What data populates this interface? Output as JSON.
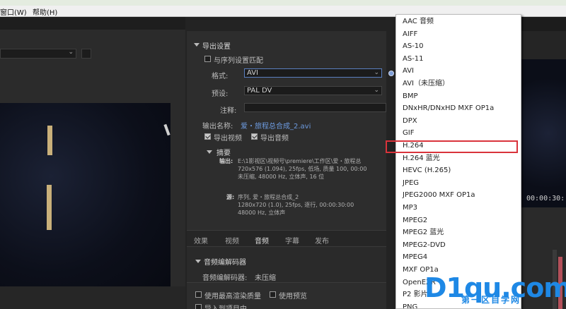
{
  "menu": {
    "items": [
      "窗口(W)",
      "帮助(H)"
    ]
  },
  "export_settings": {
    "section_title": "导出设置",
    "match_sequence_label": "与序列设置匹配",
    "format_label": "格式:",
    "format_value": "AVI",
    "preset_label": "预设:",
    "preset_value": "PAL DV",
    "comments_label": "注释:",
    "comments_value": "",
    "output_name_label": "输出名称:",
    "output_name_value": "爱・旅程总合成_2.avi",
    "export_video_label": "导出视频",
    "export_audio_label": "导出音频",
    "export_video_checked": true,
    "export_audio_checked": true
  },
  "summary": {
    "title": "摘要",
    "output_label": "输出:",
    "output_lines": [
      "E:\\1影视区\\视频号\\premiere\\工作区\\爱・旅程总",
      "720x576 (1.094), 25fps, 低场, 质量 100, 00:00",
      "未压缩, 48000 Hz, 立体声, 16 位"
    ],
    "source_label": "源:",
    "source_lines": [
      "序列, 爱・旅程总合成_2",
      "1280x720 (1.0), 25fps, 逐行, 00:00:30:00",
      "48000 Hz, 立体声"
    ]
  },
  "tabs": [
    "效果",
    "视频",
    "音频",
    "字幕",
    "发布"
  ],
  "active_tab": "音频",
  "audio_codec": {
    "section_title": "音频编解码器",
    "codec_label": "音频编解码器:",
    "codec_value": "未压缩"
  },
  "bottom_options": {
    "max_render_quality": "使用最高渲染质量",
    "use_previews": "使用预览",
    "import_into_project": "导入到项目中"
  },
  "format_dropdown": {
    "items": [
      "AAC 音频",
      "AIFF",
      "AS-10",
      "AS-11",
      "AVI",
      "AVI（未压缩）",
      "BMP",
      "DNxHR/DNxHD MXF OP1a",
      "DPX",
      "GIF",
      "H.264",
      "H.264 蓝光",
      "HEVC (H.265)",
      "JPEG",
      "JPEG2000 MXF OP1a",
      "MP3",
      "MPEG2",
      "MPEG2 蓝光",
      "MPEG2-DVD",
      "MPEG4",
      "MXF OP1a",
      "OpenEXR",
      "P2 影片",
      "PNG"
    ],
    "highlighted": "H.264",
    "highlight_color": "#d9333b"
  },
  "program_monitor": {
    "timecode": "00:00:30:"
  },
  "watermark": {
    "logo_text": "D1qu.com",
    "tagline": "第一区自学网"
  }
}
